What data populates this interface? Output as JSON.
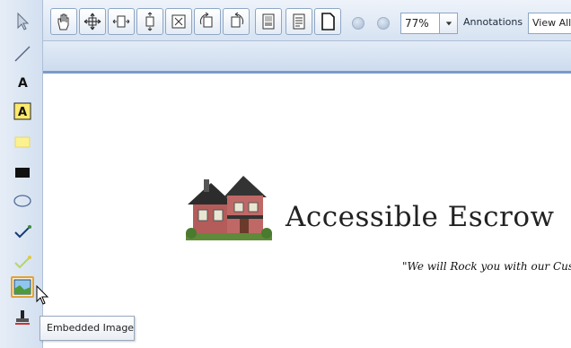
{
  "toolbar": {
    "zoom_value": "77%",
    "annotations_label": "Annotations",
    "view_value": "View All"
  },
  "document": {
    "company_name": "Accessible Escrow",
    "tagline": "\"We will Rock you with our Cust"
  },
  "tooltip": {
    "text": "Embedded Image"
  },
  "colors": {
    "toolbar_bg": "#dbe6f4",
    "accent_border": "#7a9bc7",
    "active_tool": "#e0a23a"
  }
}
